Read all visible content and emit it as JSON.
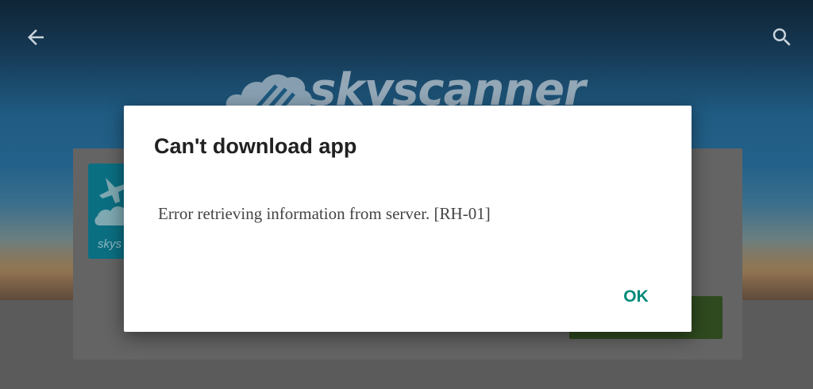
{
  "toolbar": {
    "back_icon": "arrow-left-icon",
    "search_icon": "search-icon"
  },
  "banner": {
    "brand_name": "skyscanner"
  },
  "app_card": {
    "icon_text": "skys"
  },
  "dialog": {
    "title": "Can't download app",
    "message": "Error retrieving information from server. [RH-01]",
    "ok_label": "OK"
  },
  "colors": {
    "accent": "#01897b",
    "dialog_background": "#ffffff",
    "scrim": "#5b5b5b"
  }
}
